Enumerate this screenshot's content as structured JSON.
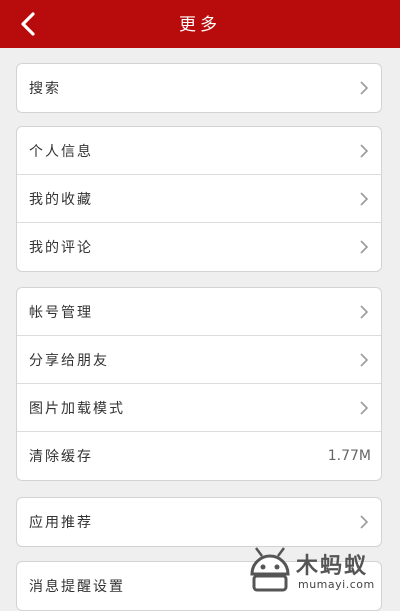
{
  "header": {
    "title": "更多",
    "back_icon": "back-arrow-icon",
    "background_color": "#b80b0b"
  },
  "group1": {
    "items": [
      {
        "label": "搜索",
        "icon": "chevron-right-icon"
      }
    ]
  },
  "group2": {
    "items": [
      {
        "label": "个人信息",
        "icon": "chevron-right-icon"
      },
      {
        "label": "我的收藏",
        "icon": "chevron-right-icon"
      },
      {
        "label": "我的评论",
        "icon": "chevron-right-icon"
      }
    ]
  },
  "group3": {
    "items": [
      {
        "label": "帐号管理",
        "icon": "chevron-right-icon"
      },
      {
        "label": "分享给朋友",
        "icon": "chevron-right-icon"
      },
      {
        "label": "图片加载模式",
        "icon": "chevron-right-icon"
      },
      {
        "label": "清除缓存",
        "value": "1.77M"
      }
    ]
  },
  "group4": {
    "items": [
      {
        "label": "应用推荐",
        "icon": "chevron-right-icon"
      }
    ]
  },
  "group5": {
    "items": [
      {
        "label": "消息提醒设置"
      }
    ]
  },
  "watermark": {
    "brand": "木蚂蚁",
    "url": "mumayi.com"
  }
}
